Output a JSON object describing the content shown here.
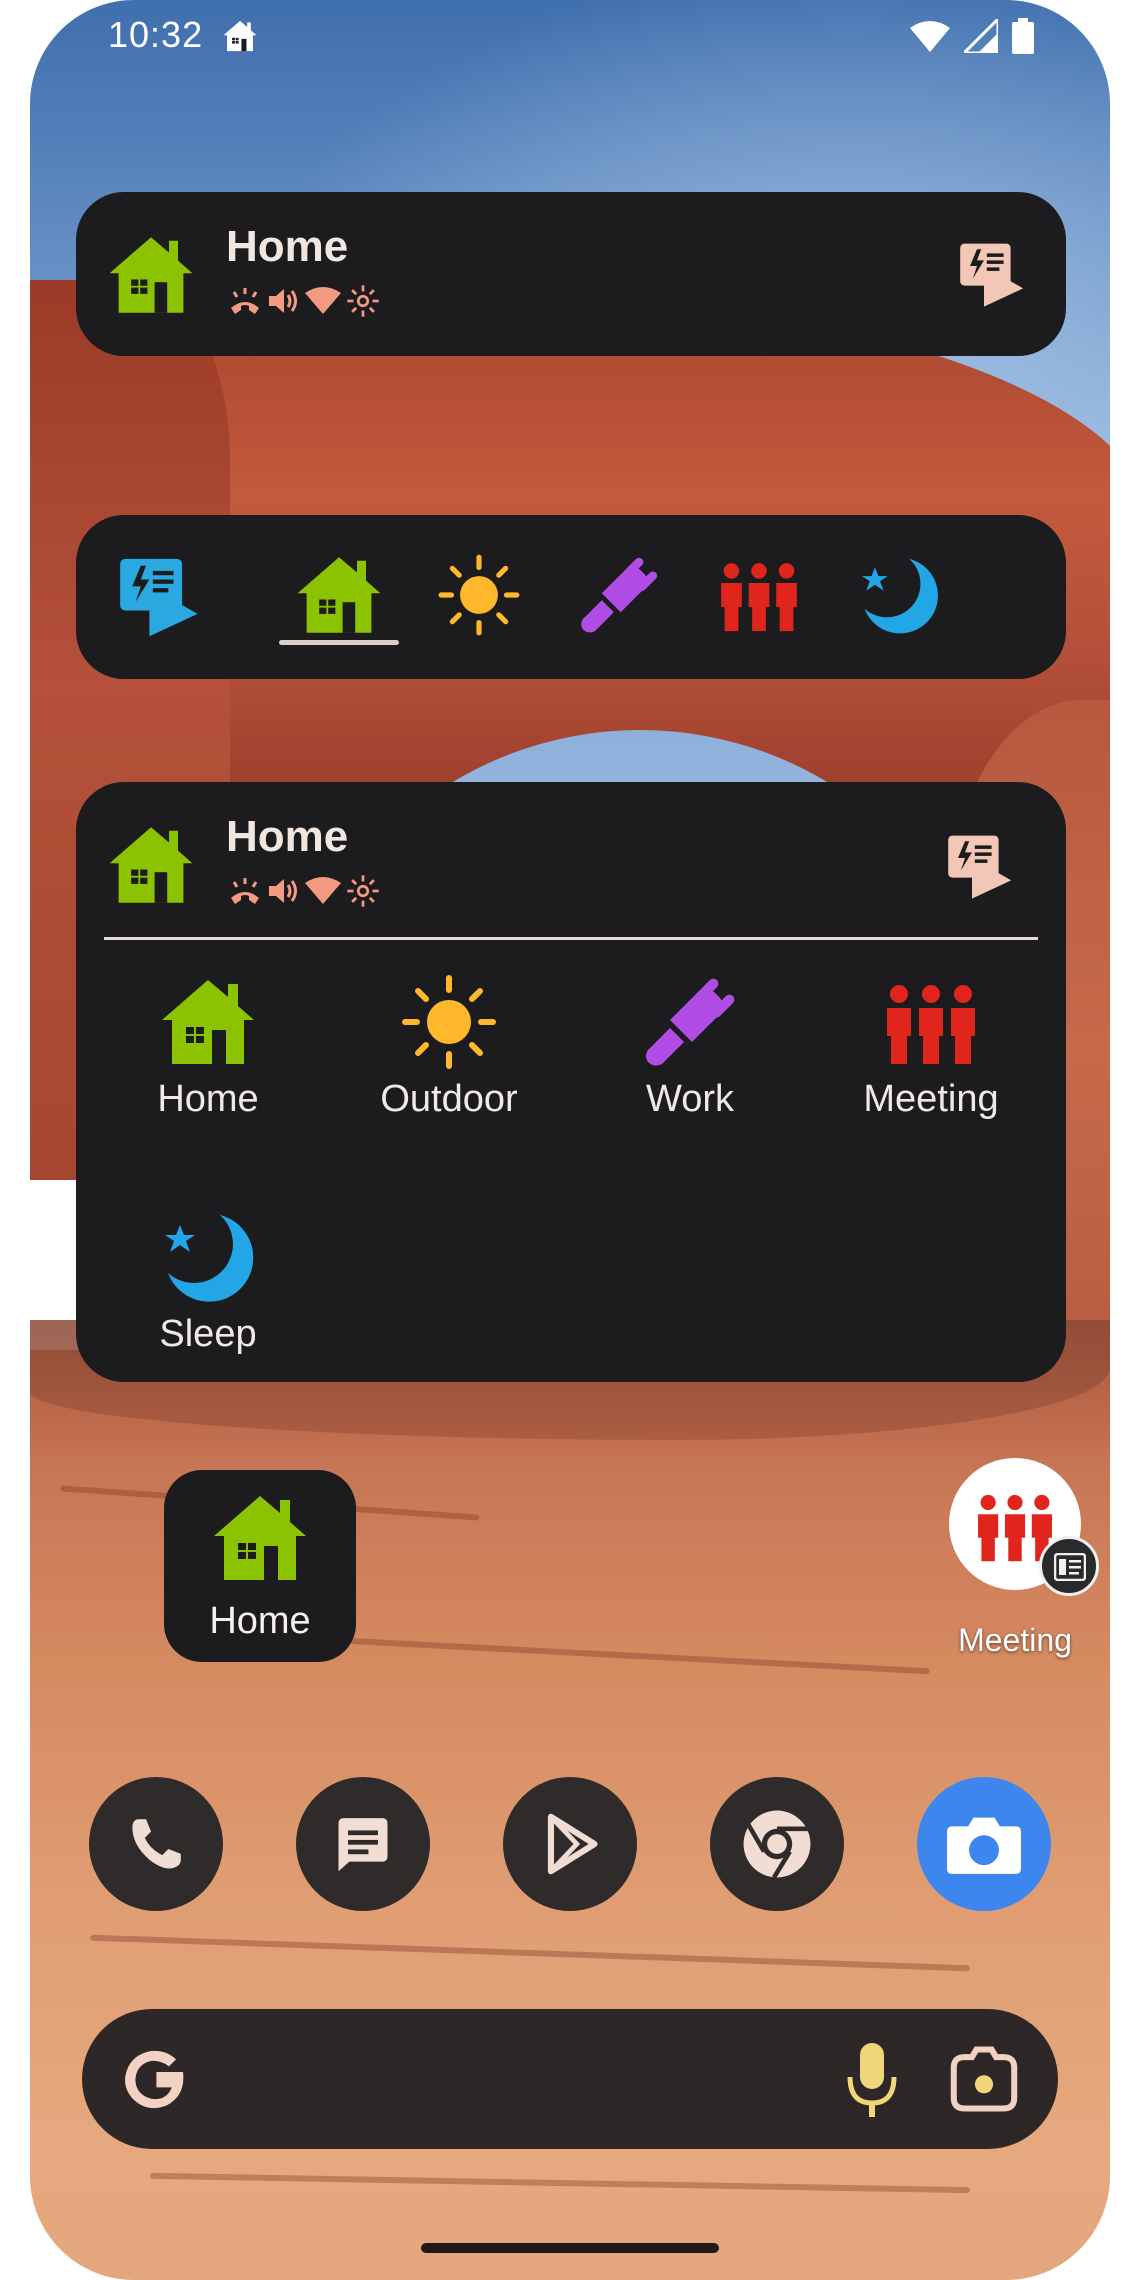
{
  "status_bar": {
    "time": "10:32"
  },
  "widgets": {
    "compact": {
      "title": "Home"
    },
    "tabs": {
      "items": [
        {
          "name": "launcher",
          "icon": "task-launcher-icon",
          "color": "#2aa9e0"
        },
        {
          "name": "home",
          "icon": "home-icon",
          "color": "#8bc300",
          "selected": true
        },
        {
          "name": "outdoor",
          "icon": "sun-icon",
          "color": "#ffb72b"
        },
        {
          "name": "work",
          "icon": "plug-icon",
          "color": "#b14de6"
        },
        {
          "name": "meeting",
          "icon": "people-icon",
          "color": "#e0251c"
        },
        {
          "name": "sleep",
          "icon": "moon-star-icon",
          "color": "#23a6e6"
        }
      ]
    },
    "expanded": {
      "title": "Home",
      "profiles": [
        {
          "label": "Home",
          "icon": "home-icon",
          "color": "#8bc300"
        },
        {
          "label": "Outdoor",
          "icon": "sun-icon",
          "color": "#ffb72b"
        },
        {
          "label": "Work",
          "icon": "plug-icon",
          "color": "#b14de6"
        },
        {
          "label": "Meeting",
          "icon": "people-icon",
          "color": "#e0251c"
        },
        {
          "label": "Sleep",
          "icon": "moon-star-icon",
          "color": "#23a6e6"
        }
      ]
    }
  },
  "home_shortcut": {
    "label": "Home"
  },
  "meeting_shortcut": {
    "label": "Meeting"
  },
  "dock": {
    "apps": [
      {
        "name": "phone",
        "icon": "phone-icon"
      },
      {
        "name": "messages",
        "icon": "message-icon"
      },
      {
        "name": "play-store",
        "icon": "play-store-icon"
      },
      {
        "name": "chrome",
        "icon": "chrome-icon"
      },
      {
        "name": "camera",
        "icon": "camera-icon"
      }
    ]
  },
  "colors": {
    "widget_bg": "#1c1b1d",
    "mini_icon": "#f39b82",
    "home_green": "#8bc300"
  }
}
